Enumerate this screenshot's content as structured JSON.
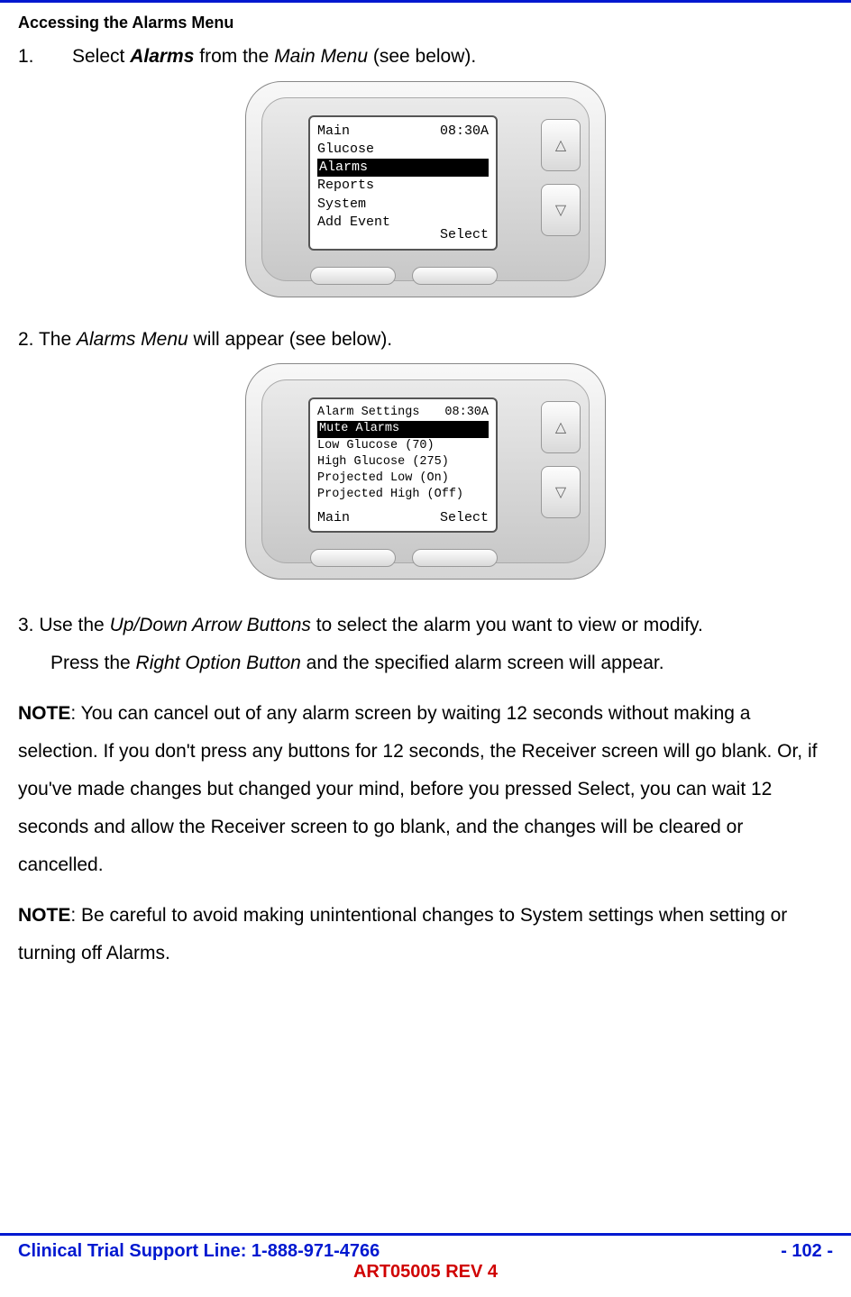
{
  "heading": "Accessing the Alarms Menu",
  "step1": {
    "num": "1.",
    "pre": "Select ",
    "bold_italic": "Alarms",
    "mid": " from the ",
    "italic": "Main Menu",
    "post": " (see below)."
  },
  "device1": {
    "title": "Main",
    "time": "08:30A",
    "items": [
      "Glucose",
      "Alarms",
      "Reports",
      "System",
      "Add Event"
    ],
    "selected_index": 1,
    "footer_left": "",
    "footer_right": "Select"
  },
  "step2": {
    "pre": "2. The ",
    "italic": "Alarms Menu",
    "post": " will appear (see below)."
  },
  "device2": {
    "title": "Alarm Settings",
    "time": "08:30A",
    "items": [
      "Mute Alarms",
      "Low Glucose (70)",
      "High Glucose (275)",
      "Projected Low (On)",
      "Projected High (Off)"
    ],
    "selected_index": 0,
    "footer_left": "Main",
    "footer_right": "Select"
  },
  "step3": {
    "num": "3.",
    "l1a": "  Use the ",
    "l1_it": "Up/Down Arrow Buttons",
    "l1b": " to select the alarm you want to view or modify.",
    "l2a": "Press the ",
    "l2_it": "Right Option Button",
    "l2b": " and the specified alarm screen will appear."
  },
  "note1": {
    "label": "NOTE",
    "body": ": You can cancel out of any alarm screen by waiting 12 seconds without making a selection. If you don't press any buttons for 12 seconds, the Receiver screen will go blank. Or, if you've made changes but changed your mind, before you pressed Select, you can wait 12 seconds and allow the Receiver screen to go blank, and the changes will be cleared or cancelled."
  },
  "note2": {
    "label": "NOTE",
    "body": ": Be careful to avoid making unintentional changes to System settings when setting or turning off Alarms."
  },
  "footer": {
    "left": "Clinical Trial Support Line:  1-888-971-4766",
    "right": "- 102 -",
    "center": "ART05005 REV 4"
  },
  "icons": {
    "up": "△",
    "down": "▽"
  }
}
